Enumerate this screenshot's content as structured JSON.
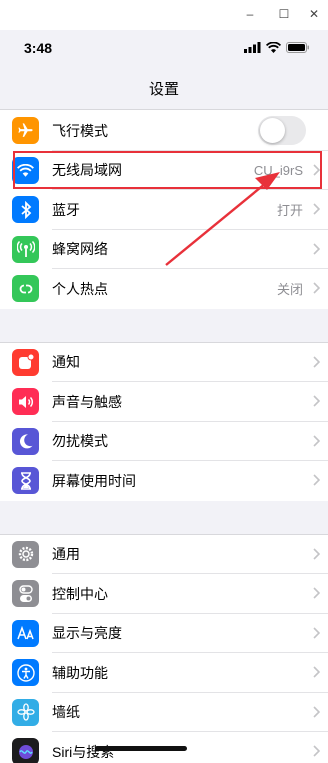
{
  "window": {
    "minimize": "–",
    "maximize": "☐",
    "close": "✕"
  },
  "status_bar": {
    "time": "3:48"
  },
  "nav": {
    "title": "设置"
  },
  "groups": [
    {
      "items": [
        {
          "id": "airplane",
          "label": "飞行模式",
          "icon": "airplane-icon",
          "color": "#ff9500",
          "toggle": false
        },
        {
          "id": "wifi",
          "label": "无线局域网",
          "value": "CU_i9rS",
          "icon": "wifi-icon",
          "color": "#007aff"
        },
        {
          "id": "bluetooth",
          "label": "蓝牙",
          "value": "打开",
          "icon": "bluetooth-icon",
          "color": "#007aff"
        },
        {
          "id": "cellular",
          "label": "蜂窝网络",
          "icon": "cellular-icon",
          "color": "#34c759"
        },
        {
          "id": "hotspot",
          "label": "个人热点",
          "value": "关闭",
          "icon": "hotspot-icon",
          "color": "#34c759"
        }
      ]
    },
    {
      "items": [
        {
          "id": "notifications",
          "label": "通知",
          "icon": "notifications-icon",
          "color": "#ff3b30"
        },
        {
          "id": "sounds",
          "label": "声音与触感",
          "icon": "speaker-icon",
          "color": "#ff2d55"
        },
        {
          "id": "dnd",
          "label": "勿扰模式",
          "icon": "moon-icon",
          "color": "#5856d6"
        },
        {
          "id": "screentime",
          "label": "屏幕使用时间",
          "icon": "hourglass-icon",
          "color": "#5856d6"
        }
      ]
    },
    {
      "items": [
        {
          "id": "general",
          "label": "通用",
          "icon": "gear-icon",
          "color": "#8e8e93"
        },
        {
          "id": "control",
          "label": "控制中心",
          "icon": "control-center-icon",
          "color": "#8e8e93"
        },
        {
          "id": "display",
          "label": "显示与亮度",
          "icon": "text-size-icon",
          "color": "#007aff"
        },
        {
          "id": "accessibility",
          "label": "辅助功能",
          "icon": "accessibility-icon",
          "color": "#007aff"
        },
        {
          "id": "wallpaper",
          "label": "墙纸",
          "icon": "wallpaper-icon",
          "color": "#32ade6"
        },
        {
          "id": "siri",
          "label": "Siri与搜索",
          "icon": "siri-icon",
          "color": "#1c1c1e"
        }
      ]
    }
  ],
  "annotation": {
    "highlight_color": "#e8313a"
  }
}
